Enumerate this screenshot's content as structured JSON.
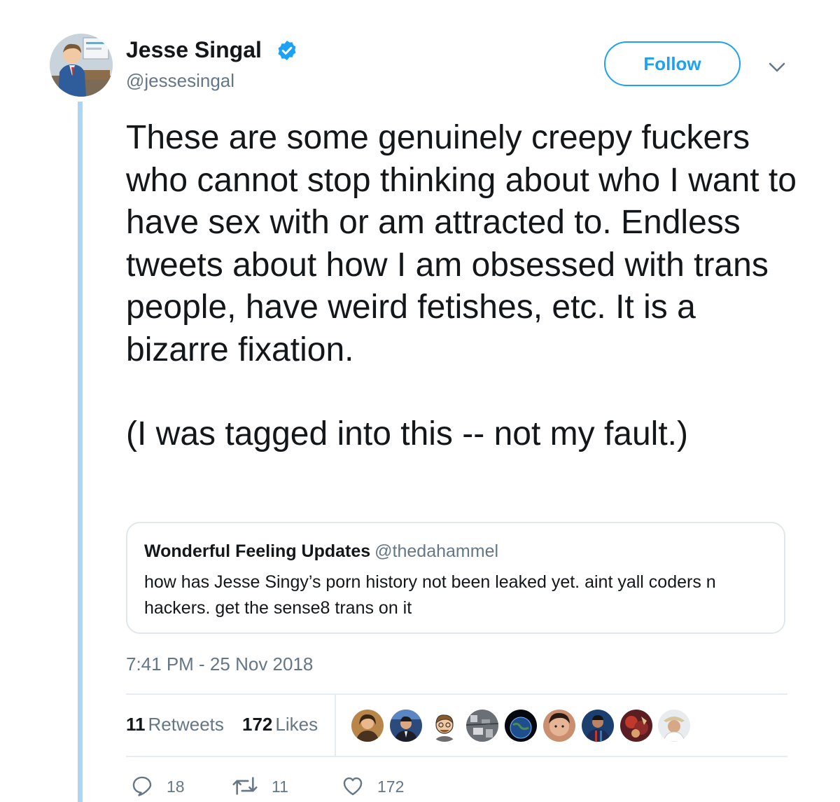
{
  "tweet": {
    "author": {
      "name": "Jesse Singal",
      "handle": "@jessesingal",
      "verified": true,
      "avatar_icon": "profile-photo-cartoon"
    },
    "follow_label": "Follow",
    "more_icon": "chevron-down-icon",
    "text_paragraphs": [
      "These are some genuinely creepy fuckers who cannot stop thinking about who I want to have sex with or am attracted to. Endless tweets about how I am obsessed with trans people, have weird fetishes, etc. It is a bizarre fixation.",
      "(I was tagged into this -- not my fault.)"
    ],
    "quoted_tweet": {
      "name": "Wonderful Feeling Updates",
      "handle": "@thedahammel",
      "text": "how has Jesse Singy’s porn history not been leaked yet. aint yall coders n hackers. get the sense8 trans on it"
    },
    "timestamp": "7:41 PM - 25 Nov 2018",
    "stats": {
      "retweets_count": "11",
      "retweets_label": "Retweets",
      "likes_count": "172",
      "likes_label": "Likes"
    },
    "liker_avatars": [
      "liker-avatar-1",
      "liker-avatar-2",
      "liker-avatar-3",
      "liker-avatar-4",
      "liker-avatar-5",
      "liker-avatar-6",
      "liker-avatar-7",
      "liker-avatar-8",
      "liker-avatar-9"
    ],
    "actions": {
      "reply_count": "18",
      "retweet_count": "11",
      "like_count": "172"
    }
  },
  "colors": {
    "accent": "#1da1f2",
    "thread_line": "#aad5f5",
    "secondary_text": "#657786",
    "primary_text": "#14171a",
    "border": "#e1e8ed"
  }
}
